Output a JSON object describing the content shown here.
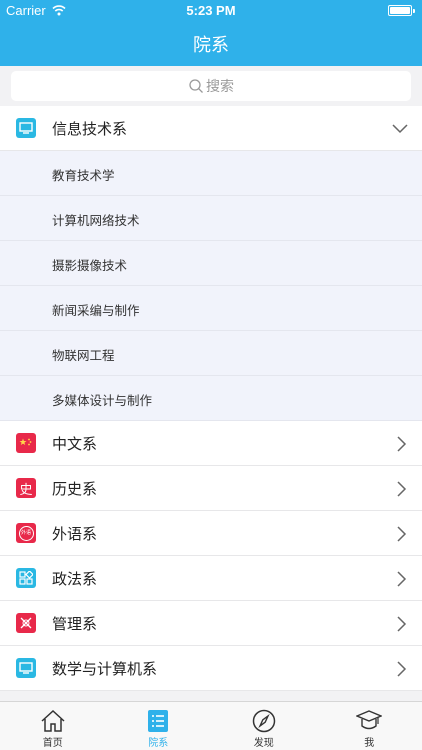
{
  "status": {
    "carrier": "Carrier",
    "time": "5:23 PM"
  },
  "nav": {
    "title": "院系"
  },
  "search": {
    "placeholder": "搜索"
  },
  "colors": {
    "accent": "#2fb1ea",
    "red": "#e8294a",
    "cyan": "#2ab8e3"
  },
  "departments": {
    "expanded": {
      "label": "信息技术系",
      "icon": "monitor-icon",
      "majors": [
        "教育技术学",
        "计算机网络技术",
        "摄影摄像技术",
        "新闻采编与制作",
        "物联网工程",
        "多媒体设计与制作"
      ]
    },
    "others": [
      {
        "label": "中文系",
        "icon": "flag-icon"
      },
      {
        "label": "历史系",
        "icon": "history-icon",
        "glyph": "史"
      },
      {
        "label": "外语系",
        "icon": "language-icon",
        "glyph": "外语"
      },
      {
        "label": "政法系",
        "icon": "grid-icon"
      },
      {
        "label": "管理系",
        "icon": "x-pattern-icon"
      },
      {
        "label": "数学与计算机系",
        "icon": "monitor-icon"
      }
    ]
  },
  "tabs": [
    {
      "label": "首页",
      "icon": "home-icon",
      "active": false
    },
    {
      "label": "院系",
      "icon": "list-icon",
      "active": true
    },
    {
      "label": "发现",
      "icon": "compass-icon",
      "active": false
    },
    {
      "label": "我",
      "icon": "graduation-cap-icon",
      "active": false
    }
  ]
}
